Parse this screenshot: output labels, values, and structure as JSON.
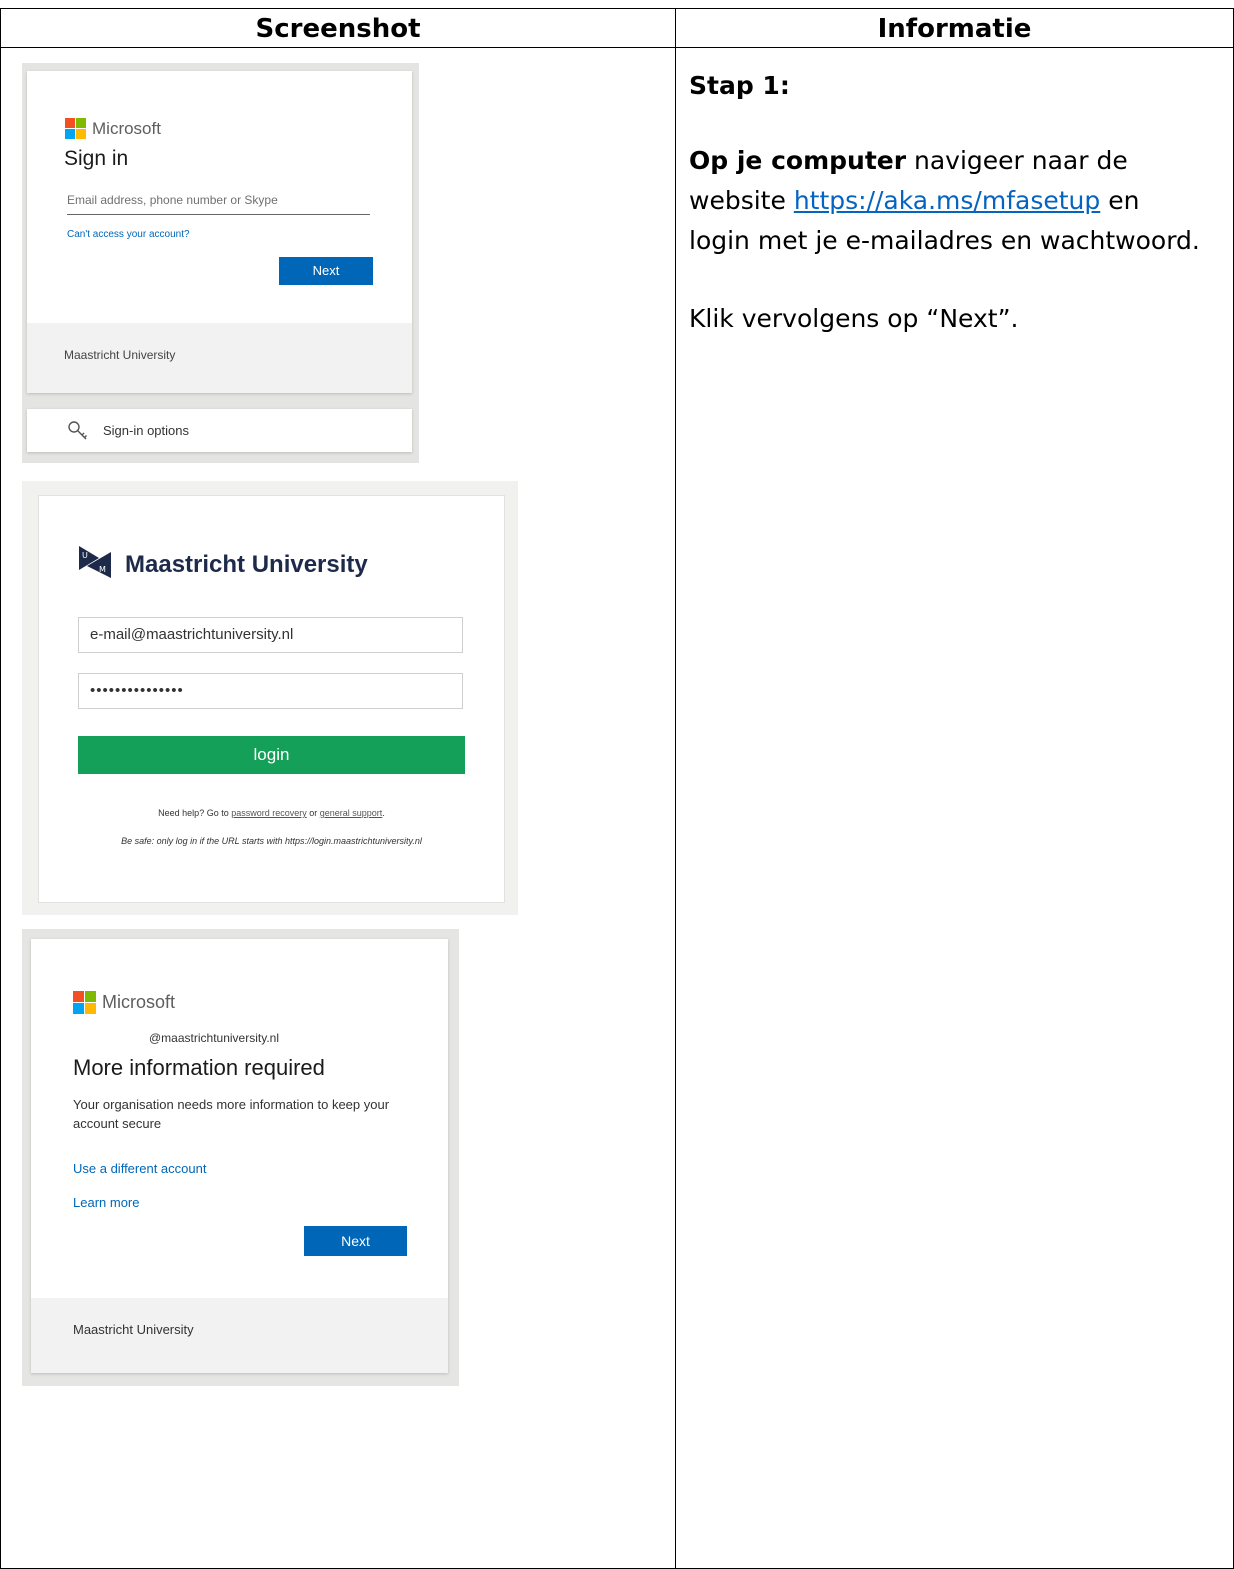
{
  "table": {
    "header_left": "Screenshot",
    "header_right": "Informatie"
  },
  "colors": {
    "ms_blue": "#0067b8",
    "um_green": "#15a05a",
    "link_blue": "#0563c1",
    "ms_logo": [
      "#f25022",
      "#7fba00",
      "#00a4ef",
      "#ffb900"
    ]
  },
  "screenshot1": {
    "brand": "Microsoft",
    "title": "Sign in",
    "input_placeholder": "Email address, phone number or Skype",
    "link": "Can't access your account?",
    "next_button": "Next",
    "footer": "Maastricht University",
    "options_icon": "key-icon",
    "options_label": "Sign-in options"
  },
  "screenshot2": {
    "logo_icon": "um-logo-icon",
    "title": "Maastricht University",
    "email_value": "e-mail@maastrichtuniversity.nl",
    "password_value": "•••••••••••••••",
    "login_button": "login",
    "help_prefix": "Need help? Go to ",
    "help_link1": "password recovery",
    "help_mid": " or ",
    "help_link2": "general support",
    "help_suffix": ".",
    "safe_note": "Be safe: only log in if the URL starts with https://login.maastrichtuniversity.nl"
  },
  "screenshot3": {
    "brand": "Microsoft",
    "user": "@maastrichtuniversity.nl",
    "title": "More information required",
    "description": "Your organisation needs more information to keep your account secure",
    "link1": "Use a different account",
    "link2": "Learn more",
    "next_button": "Next",
    "footer": "Maastricht University"
  },
  "info": {
    "step": "Stap 1:",
    "bold_lead": "Op je computer",
    "line1_rest": " navigeer naar de",
    "line2_prefix": "website ",
    "url": "https://aka.ms/mfasetup",
    "line2_suffix": " en",
    "line3": "login met je e-mailadres en wachtwoord.",
    "instruction": "Klik vervolgens op “Next”."
  }
}
